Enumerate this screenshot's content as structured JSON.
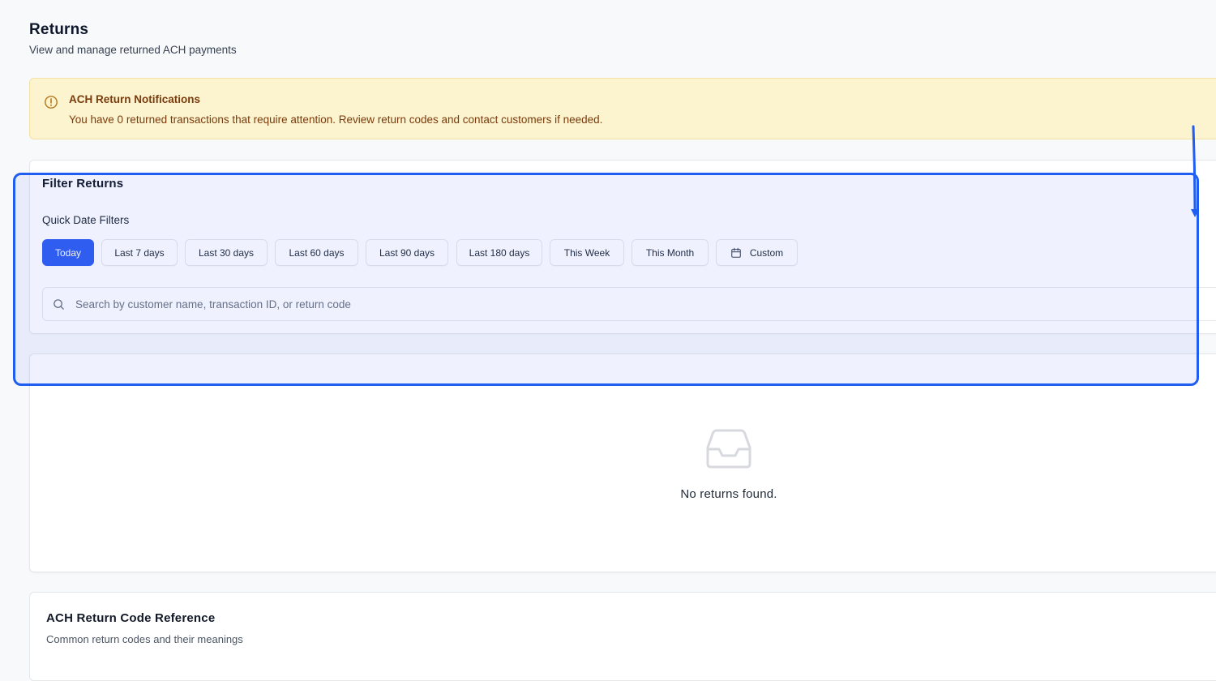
{
  "header": {
    "title": "Returns",
    "subtitle": "View and manage returned ACH payments"
  },
  "alert": {
    "icon": "alert-circle-icon",
    "title": "ACH Return Notifications",
    "message": "You have 0 returned transactions that require attention. Review return codes and contact customers if needed.",
    "colors": {
      "background": "#fcf3cf",
      "text": "#7a3b0c"
    }
  },
  "filters": {
    "title": "Filter Returns",
    "quick_label": "Quick Date Filters",
    "chips": [
      {
        "label": "Today",
        "active": true
      },
      {
        "label": "Last 7 days",
        "active": false
      },
      {
        "label": "Last 30 days",
        "active": false
      },
      {
        "label": "Last 60 days",
        "active": false
      },
      {
        "label": "Last 90 days",
        "active": false
      },
      {
        "label": "Last 180 days",
        "active": false
      },
      {
        "label": "This Week",
        "active": false
      },
      {
        "label": "This Month",
        "active": false
      },
      {
        "label": "Custom",
        "active": false,
        "icon": "calendar-icon"
      }
    ],
    "search_placeholder": "Search by customer name, transaction ID, or return code",
    "search_value": ""
  },
  "results": {
    "empty_icon": "inbox-icon",
    "empty_message": "No returns found."
  },
  "reference": {
    "title": "ACH Return Code Reference",
    "subtitle": "Common return codes and their meanings"
  },
  "colors": {
    "accent": "#2f5ef0",
    "highlight": "#1f5ef0",
    "page_background": "#f8f9fb"
  }
}
